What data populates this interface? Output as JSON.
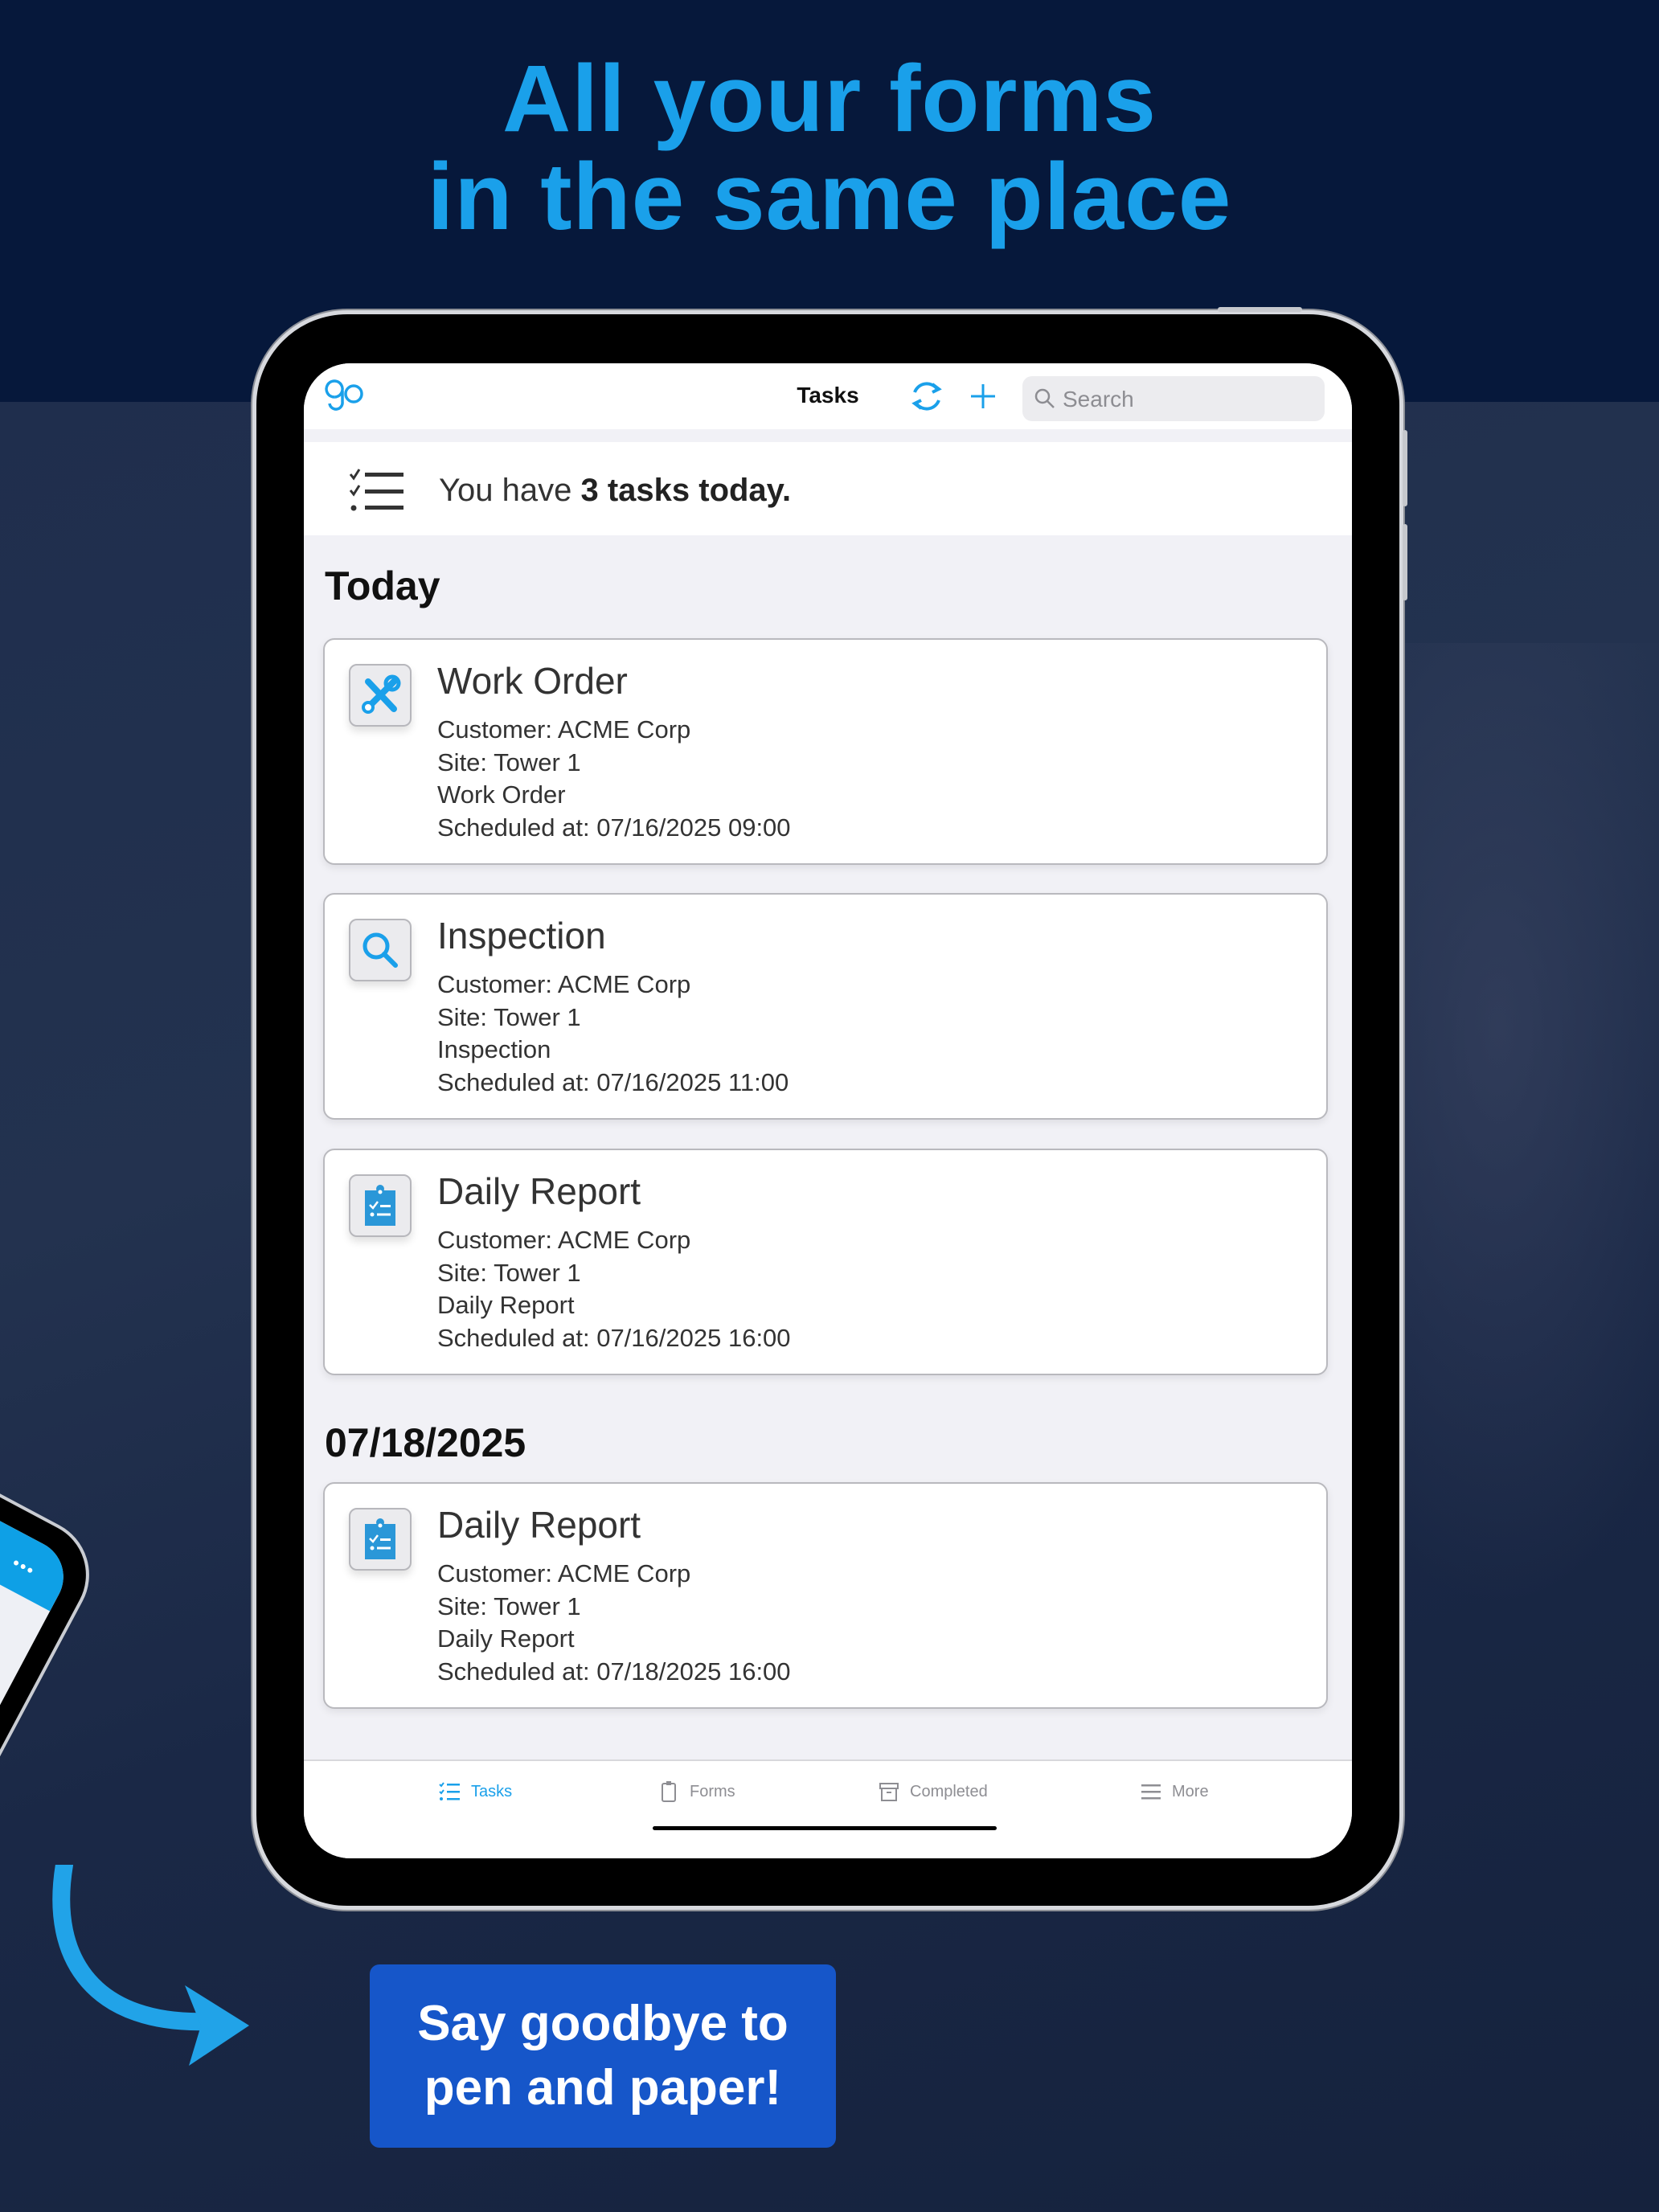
{
  "marketing": {
    "headline_line1": "All your forms",
    "headline_line2": "in the same place",
    "cta_line1": "Say goodbye to",
    "cta_line2": "pen and paper!",
    "accent_color": "#1aa0ea",
    "cta_color": "#1656c9"
  },
  "app": {
    "topbar": {
      "logo": "go-logo",
      "title": "Tasks",
      "refresh_icon": "refresh-icon",
      "add_icon": "plus-icon",
      "search_placeholder": "Search"
    },
    "summary": {
      "prefix": "You have ",
      "count_text": "3 tasks today."
    },
    "sections": [
      {
        "title": "Today",
        "cards": [
          {
            "icon": "tools-icon",
            "title": "Work Order",
            "customer": "Customer: ACME Corp",
            "site": "Site: Tower 1",
            "form": "Work Order",
            "scheduled": "Scheduled at: 07/16/2025 09:00"
          },
          {
            "icon": "search-icon",
            "title": "Inspection",
            "customer": "Customer: ACME Corp",
            "site": "Site: Tower 1",
            "form": "Inspection",
            "scheduled": "Scheduled at: 07/16/2025 11:00"
          },
          {
            "icon": "clipboard-checklist-icon",
            "title": "Daily Report",
            "customer": "Customer: ACME Corp",
            "site": "Site: Tower 1",
            "form": "Daily Report",
            "scheduled": "Scheduled at: 07/16/2025 16:00"
          }
        ]
      },
      {
        "title": "07/18/2025",
        "cards": [
          {
            "icon": "clipboard-checklist-icon",
            "title": "Daily Report",
            "customer": "Customer: ACME Corp",
            "site": "Site: Tower 1",
            "form": "Daily Report",
            "scheduled": "Scheduled at: 07/18/2025 16:00"
          }
        ]
      }
    ],
    "tabs": [
      {
        "label": "Tasks",
        "icon": "checklist-icon",
        "active": true
      },
      {
        "label": "Forms",
        "icon": "clipboard-icon",
        "active": false
      },
      {
        "label": "Completed",
        "icon": "archive-icon",
        "active": false
      },
      {
        "label": "More",
        "icon": "menu-icon",
        "active": false
      }
    ]
  }
}
